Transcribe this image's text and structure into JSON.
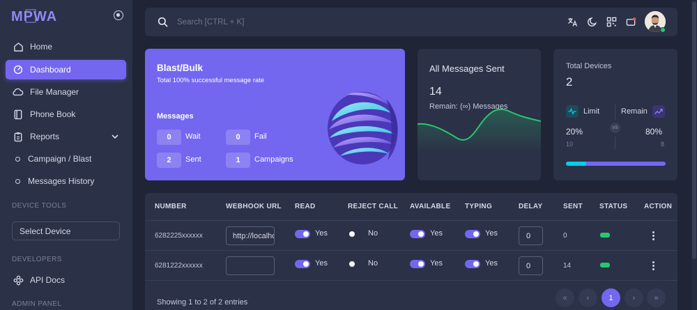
{
  "app": {
    "logo_text": "MPWA"
  },
  "sidebar": {
    "items": [
      {
        "label": "Home",
        "icon": "home-icon"
      },
      {
        "label": "Dashboard",
        "icon": "dashboard-icon",
        "active": true
      },
      {
        "label": "File Manager",
        "icon": "cloud-icon"
      },
      {
        "label": "Phone Book",
        "icon": "book-icon"
      },
      {
        "label": "Reports",
        "icon": "report-icon"
      }
    ],
    "sub_items": [
      {
        "label": "Campaign / Blast"
      },
      {
        "label": "Messages History"
      }
    ],
    "sections": {
      "device_tools": "DEVICE TOOLS",
      "developers": "DEVELOPERS",
      "admin_panel": "ADMIN PANEL"
    },
    "select_device": "Select Device",
    "api_docs": "API Docs"
  },
  "topbar": {
    "search_placeholder": "Search [CTRL + K]"
  },
  "blast_card": {
    "title": "Blast/Bulk",
    "subtitle": "Total 100% successful message rate",
    "messages_heading": "Messages",
    "stats": [
      {
        "value": "0",
        "label": "Wait"
      },
      {
        "value": "0",
        "label": "Fail"
      },
      {
        "value": "2",
        "label": "Sent"
      },
      {
        "value": "1",
        "label": "Campaigns"
      }
    ]
  },
  "messages_card": {
    "title": "All Messages Sent",
    "count": "14",
    "remain": "Remain: (∞) Messages"
  },
  "devices_card": {
    "title": "Total Devices",
    "count": "2",
    "limit_label": "Limit",
    "remain_label": "Remain",
    "limit_pct": "20%",
    "remain_pct": "80%",
    "limit_value": "10",
    "remain_value": "8",
    "vs": "VS",
    "progress_fraction": 0.2
  },
  "table": {
    "headers": [
      "NUMBER",
      "WEBHOOK URL",
      "READ",
      "REJECT CALL",
      "AVAILABLE",
      "TYPING",
      "DELAY",
      "SENT",
      "STATUS",
      "ACTION"
    ],
    "rows": [
      {
        "number": "6282225xxxxxx",
        "webhook": "http://localhost",
        "read": "Yes",
        "reject": "No",
        "available": "Yes",
        "typing": "Yes",
        "delay": "0",
        "sent": "0"
      },
      {
        "number": "6281222xxxxxx",
        "webhook": "",
        "read": "Yes",
        "reject": "No",
        "available": "Yes",
        "typing": "Yes",
        "delay": "0",
        "sent": "14"
      }
    ],
    "footer": "Showing 1 to 2 of 2 entries",
    "pagination": {
      "first": "«",
      "prev": "‹",
      "current": "1",
      "next": "›",
      "last": "»"
    }
  },
  "colors": {
    "accent": "#7367f0",
    "success": "#28c76f",
    "info": "#00cfe8"
  }
}
